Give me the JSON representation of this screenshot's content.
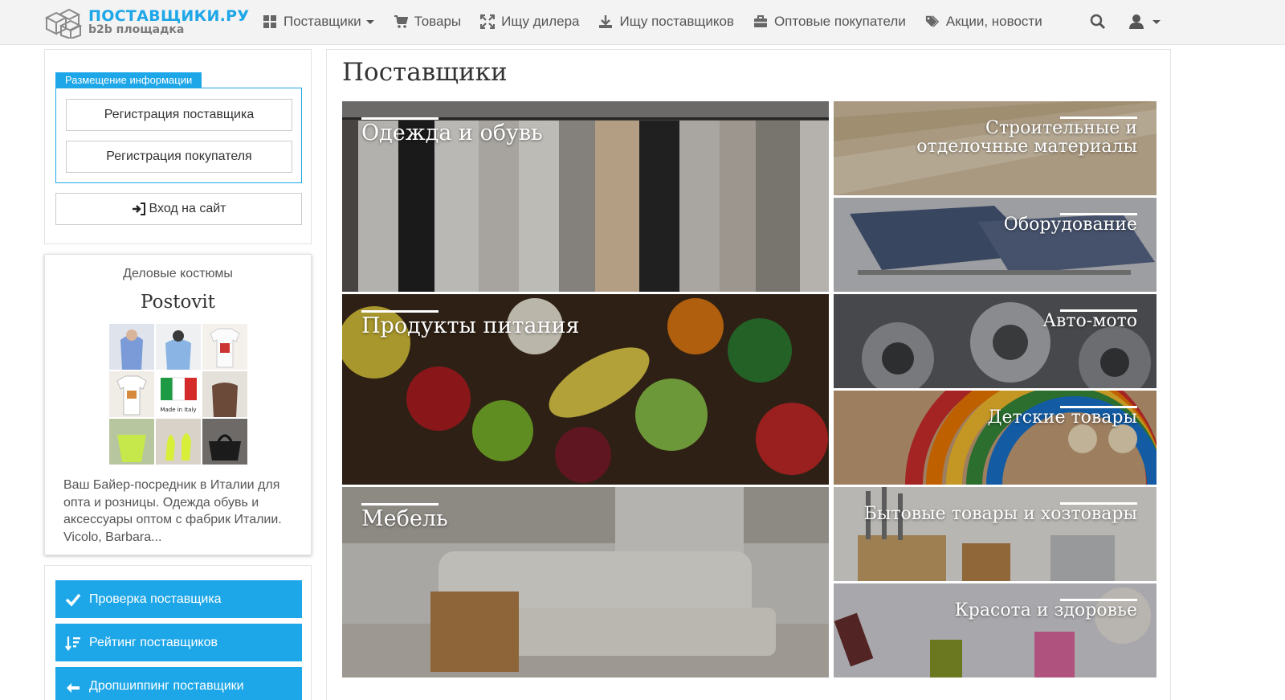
{
  "brand": {
    "name": "ПОСТАВЩИКИ.РУ",
    "tagline": "b2b площадка"
  },
  "nav": {
    "items": [
      {
        "label": "Поставщики",
        "icon": "grid-icon",
        "dropdown": true
      },
      {
        "label": "Товары",
        "icon": "cart-icon",
        "dropdown": false
      },
      {
        "label": "Ищу дилера",
        "icon": "expand-icon",
        "dropdown": false
      },
      {
        "label": "Ищу поставщиков",
        "icon": "download-icon",
        "dropdown": false
      },
      {
        "label": "Оптовые покупатели",
        "icon": "briefcase-icon",
        "dropdown": false
      },
      {
        "label": "Акции, новости",
        "icon": "tags-icon",
        "dropdown": false
      }
    ]
  },
  "sidebar": {
    "placement_legend": "Размещение информации",
    "register_supplier": "Регистрация поставщика",
    "register_buyer": "Регистрация покупателя",
    "login": "Вход на сайт",
    "ad": {
      "category": "Деловые костюмы",
      "company": "Postovit",
      "made_in": "Made in Italy",
      "description": "Ваш Байер-посредник в Италии для опта и розницы. Одежда обувь и аксессуары оптом с фабрик Италии. Vicolo, Barbara..."
    },
    "links": [
      {
        "label": "Проверка поставщика",
        "icon": "check-icon"
      },
      {
        "label": "Рейтинг поставщиков",
        "icon": "sort-icon"
      },
      {
        "label": "Дропшиппинг поставщики",
        "icon": "arrow-icon"
      }
    ]
  },
  "main": {
    "title": "Поставщики",
    "categories_big": [
      "Одежда и обувь",
      "Продукты питания",
      "Мебель"
    ],
    "categories_small": [
      "Строительные и отделочные материалы",
      "Оборудование",
      "Авто-мото",
      "Детские товары",
      "Бытовые товары и хозтовары",
      "Красота и здоровье"
    ]
  },
  "colors": {
    "accent": "#1ea7e8",
    "nav_bg": "#f3f3f3"
  }
}
